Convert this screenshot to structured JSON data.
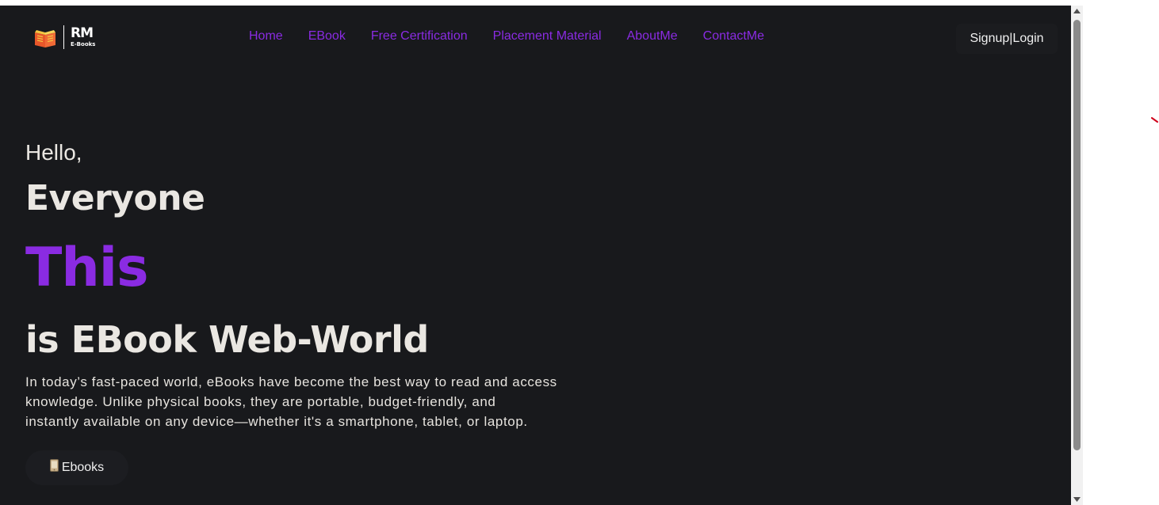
{
  "logo": {
    "mark": "RM",
    "sub": "E-Books"
  },
  "nav": {
    "links": [
      {
        "label": "Home"
      },
      {
        "label": "EBook"
      },
      {
        "label": "Free Certification"
      },
      {
        "label": "Placement Material"
      },
      {
        "label": "AboutMe"
      },
      {
        "label": "ContactMe"
      }
    ],
    "auth_label": "Signup|Login"
  },
  "hero": {
    "greeting": "Hello,",
    "headline": "Everyone",
    "highlight": "This",
    "subheadline": "is EBook Web-World",
    "description_lines": [
      "In today’s fast-paced world, eBooks have become the best way to read and access",
      "knowledge. Unlike physical books, they are portable, budget-friendly, and",
      "instantly available on any device—whether it's a smartphone, tablet, or laptop."
    ],
    "cta_label": "Ebooks",
    "cta_icon": "phone-icon"
  },
  "colors": {
    "background": "#18191c",
    "accent": "#8a2be2",
    "text": "#eae7e2"
  }
}
